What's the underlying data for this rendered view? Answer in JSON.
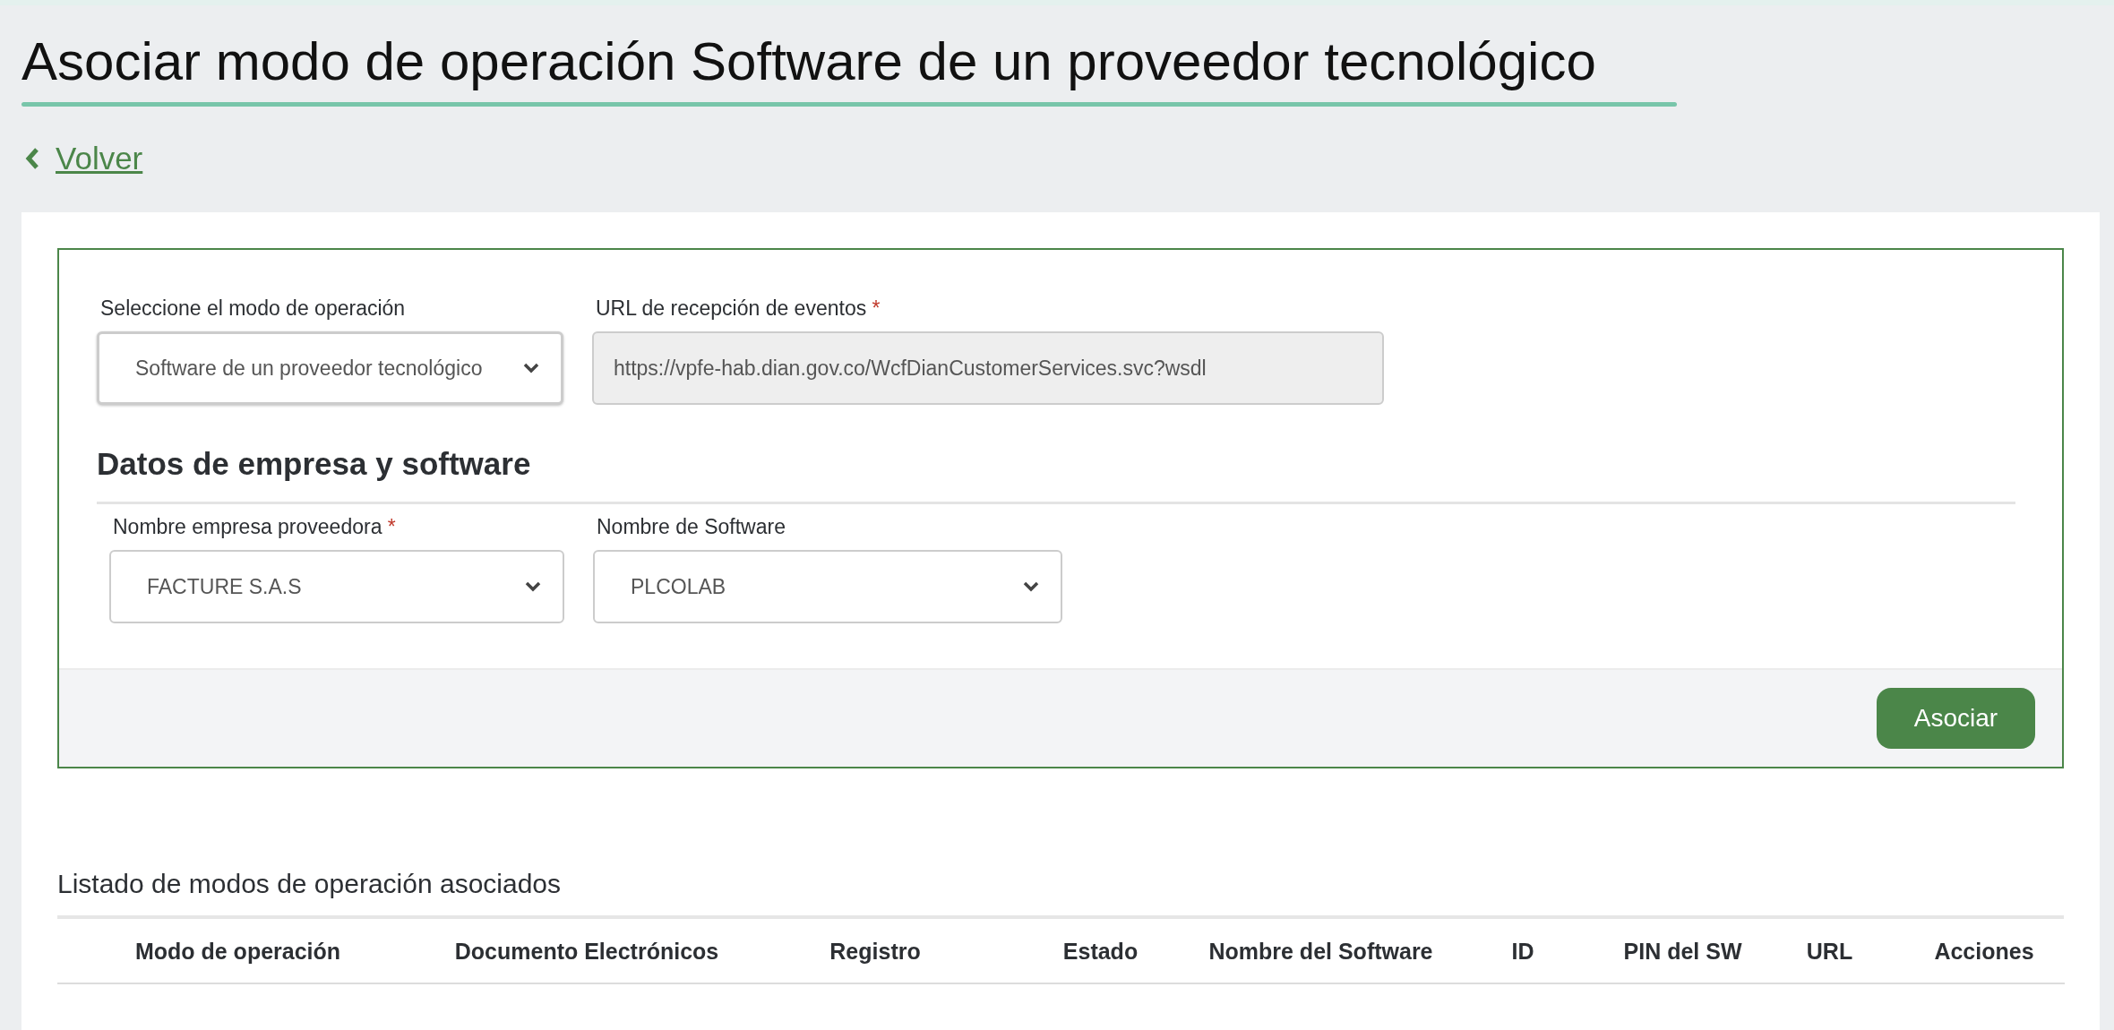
{
  "page": {
    "title": "Asociar modo de operación Software de un proveedor tecnológico",
    "back_link": "Volver"
  },
  "form": {
    "fields": [
      {
        "kind": "select",
        "label": "Seleccione el modo de operación",
        "value": "Software de un proveedor tecnológico",
        "disabled": false
      },
      {
        "kind": "text",
        "label": "URL de recepción de eventos",
        "required_mark": "*",
        "value": "https://vpfe-hab.dian.gov.co/WcfDianCustomerServices.svc?wsdl",
        "disabled": true
      }
    ],
    "section_title": "Datos de empresa y software",
    "section_fields": [
      {
        "kind": "select",
        "label": "Nombre empresa proveedora",
        "required_mark": "*",
        "value": "FACTURE S.A.S",
        "disabled": false
      },
      {
        "kind": "select",
        "label": "Nombre de Software",
        "value": "PLCOLAB",
        "disabled": false
      }
    ],
    "submit_button": "Asociar"
  },
  "table": {
    "title": "Listado de modos de operación asociados",
    "columns": [
      "Modo de operación",
      "Documento Electrónicos",
      "Registro",
      "Estado",
      "Nombre del Software",
      "ID",
      "PIN del SW",
      "URL",
      "Acciones"
    ]
  }
}
